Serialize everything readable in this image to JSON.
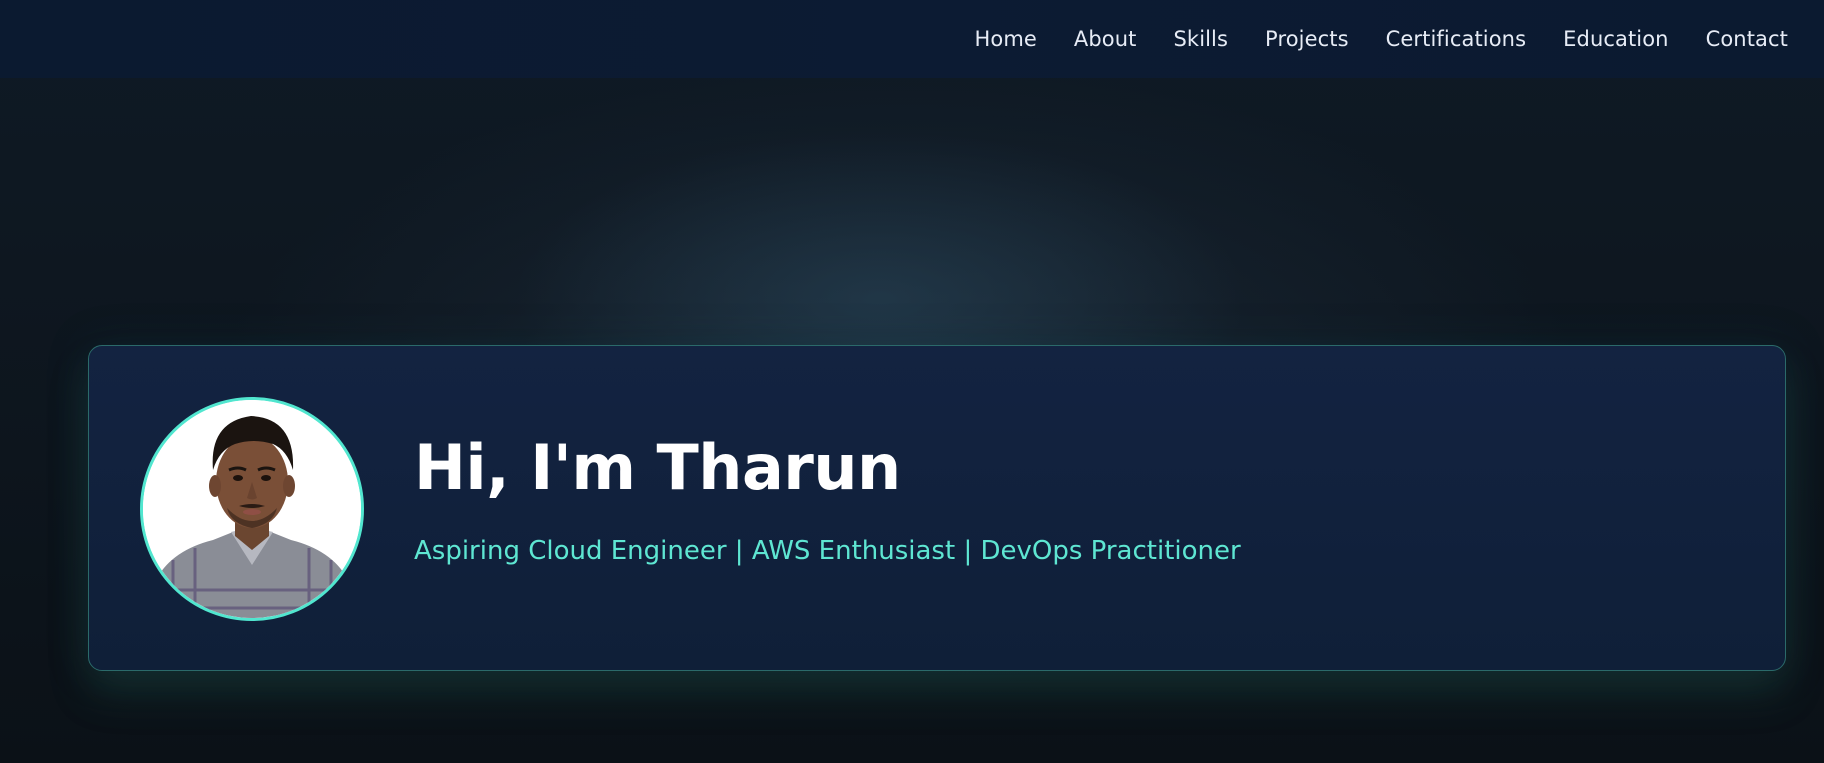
{
  "nav": {
    "items": [
      {
        "label": "Home"
      },
      {
        "label": "About"
      },
      {
        "label": "Skills"
      },
      {
        "label": "Projects"
      },
      {
        "label": "Certifications"
      },
      {
        "label": "Education"
      },
      {
        "label": "Contact"
      }
    ]
  },
  "hero": {
    "title": "Hi, I'm Tharun",
    "subtitle": "Aspiring Cloud Engineer | AWS Enthusiast | DevOps Practitioner",
    "avatar_icon": "profile-photo"
  },
  "colors": {
    "accent": "#5ee6d2",
    "nav_background": "#0b1a30",
    "card_background": "#132341",
    "page_background": "#0f1a25"
  }
}
